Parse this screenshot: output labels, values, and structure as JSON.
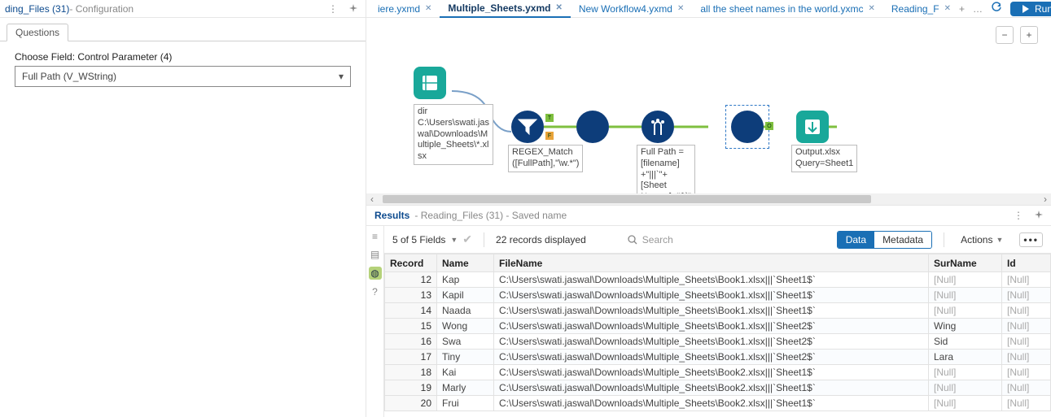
{
  "config_panel": {
    "title_prefix": "ding_Files (31)",
    "title_suffix": " - Configuration",
    "menu_icon": "⋮",
    "pin_icon": "📌",
    "tab_label": "Questions",
    "field_caption": "Choose Field: Control Parameter (4)",
    "dropdown_value": "Full Path (V_WString)"
  },
  "file_tabs": {
    "items": [
      {
        "label": "iere.yxmd",
        "active": false
      },
      {
        "label": "Multiple_Sheets.yxmd",
        "active": true
      },
      {
        "label": "New Workflow4.yxmd",
        "active": false
      },
      {
        "label": "all the sheet names in the world.yxmc",
        "active": false
      },
      {
        "label": "Reading_F",
        "active": false
      }
    ],
    "plus": "+",
    "more": "…",
    "refresh": "↻",
    "run_label": "Run"
  },
  "canvas": {
    "minus": "−",
    "plus": "+",
    "dir_label": "dir\nC:\\Users\\swati.jas\nwal\\Downloads\\M\nultiple_Sheets\\*.xl\nsx",
    "regex_label": "REGEX_Match\n([FullPath],\"\\w.*\")",
    "formula_label": "Full Path =\n[filename]\n+\"|||`\"+[Sheet\nNames]+\"$`\"",
    "output_label": "Output.xlsx\nQuery=Sheet1",
    "anchor_T": "T",
    "anchor_F": "F",
    "anchor_O": "O"
  },
  "results": {
    "title": "Results",
    "subtitle": " - Reading_Files (31) - Saved name",
    "menu": "⋮",
    "pin": "📌",
    "fields_label": "5 of 5 Fields",
    "records_label": "22 records displayed",
    "search_placeholder": "Search",
    "seg_data": "Data",
    "seg_meta": "Metadata",
    "actions": "Actions",
    "cell_btn": "▥",
    "columns": [
      "Record",
      "Name",
      "FileName",
      "SurName",
      "Id"
    ],
    "rows": [
      {
        "rec": "12",
        "name": "Kap",
        "file": "C:\\Users\\swati.jaswal\\Downloads\\Multiple_Sheets\\Book1.xlsx|||`Sheet1$`",
        "sur": "[Null]",
        "id": "[Null]"
      },
      {
        "rec": "13",
        "name": "Kapil",
        "file": "C:\\Users\\swati.jaswal\\Downloads\\Multiple_Sheets\\Book1.xlsx|||`Sheet1$`",
        "sur": "[Null]",
        "id": "[Null]"
      },
      {
        "rec": "14",
        "name": "Naada",
        "file": "C:\\Users\\swati.jaswal\\Downloads\\Multiple_Sheets\\Book1.xlsx|||`Sheet1$`",
        "sur": "[Null]",
        "id": "[Null]"
      },
      {
        "rec": "15",
        "name": "Wong",
        "file": "C:\\Users\\swati.jaswal\\Downloads\\Multiple_Sheets\\Book1.xlsx|||`Sheet2$`",
        "sur": "Wing",
        "id": "[Null]"
      },
      {
        "rec": "16",
        "name": "Swa",
        "file": "C:\\Users\\swati.jaswal\\Downloads\\Multiple_Sheets\\Book1.xlsx|||`Sheet2$`",
        "sur": "Sid",
        "id": "[Null]"
      },
      {
        "rec": "17",
        "name": "Tiny",
        "file": "C:\\Users\\swati.jaswal\\Downloads\\Multiple_Sheets\\Book1.xlsx|||`Sheet2$`",
        "sur": "Lara",
        "id": "[Null]"
      },
      {
        "rec": "18",
        "name": "Kai",
        "file": "C:\\Users\\swati.jaswal\\Downloads\\Multiple_Sheets\\Book2.xlsx|||`Sheet1$`",
        "sur": "[Null]",
        "id": "[Null]"
      },
      {
        "rec": "19",
        "name": "Marly",
        "file": "C:\\Users\\swati.jaswal\\Downloads\\Multiple_Sheets\\Book2.xlsx|||`Sheet1$`",
        "sur": "[Null]",
        "id": "[Null]"
      },
      {
        "rec": "20",
        "name": "Frui",
        "file": "C:\\Users\\swati.jaswal\\Downloads\\Multiple_Sheets\\Book2.xlsx|||`Sheet1$`",
        "sur": "[Null]",
        "id": "[Null]"
      }
    ]
  }
}
